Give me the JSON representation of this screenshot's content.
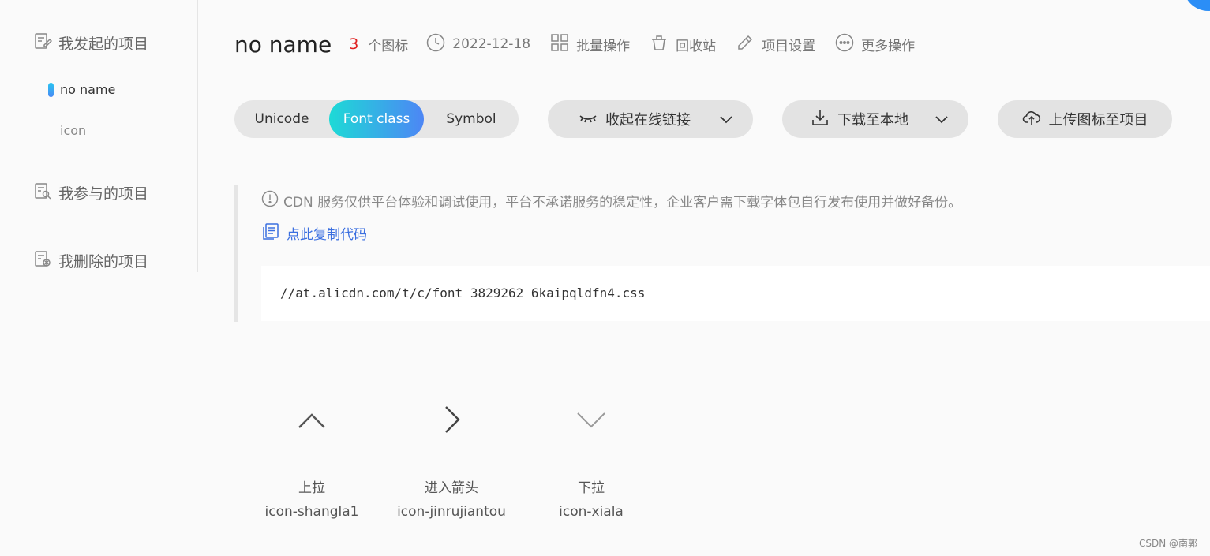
{
  "sidebar": {
    "my_projects": "我发起的项目",
    "projects": [
      {
        "label": "no name",
        "active": true
      },
      {
        "label": "icon",
        "active": false
      }
    ],
    "joined_projects": "我参与的项目",
    "deleted_projects": "我删除的项目"
  },
  "header": {
    "title": "no name",
    "icon_count": "3",
    "icon_count_label": "个图标",
    "date": "2022-12-18",
    "batch": "批量操作",
    "recycle": "回收站",
    "settings": "项目设置",
    "more": "更多操作"
  },
  "toolbar": {
    "tabs": [
      "Unicode",
      "Font class",
      "Symbol"
    ],
    "active_tab": "Font class",
    "collapse_link": "收起在线链接",
    "download": "下载至本地",
    "upload": "上传图标至项目"
  },
  "info": {
    "notice": "CDN 服务仅供平台体验和调试使用，平台不承诺服务的稳定性，企业客户需下载字体包自行发布使用并做好备份。",
    "copy_code": "点此复制代码",
    "css_url": "//at.alicdn.com/t/c/font_3829262_6kaipqldfn4.css"
  },
  "icons": [
    {
      "name": "上拉",
      "class": "icon-shangla1",
      "glyph": "chevron-up-icon"
    },
    {
      "name": "进入箭头",
      "class": "icon-jinrujiantou",
      "glyph": "chevron-right-icon"
    },
    {
      "name": "下拉",
      "class": "icon-xiala",
      "glyph": "chevron-down-icon"
    }
  ],
  "watermark": "CSDN @南郭",
  "colors": {
    "accent_gradient_start": "#1ddad6",
    "accent_gradient_end": "#4d86f5",
    "icon_count": "#e02020",
    "link": "#3b6fe0"
  }
}
